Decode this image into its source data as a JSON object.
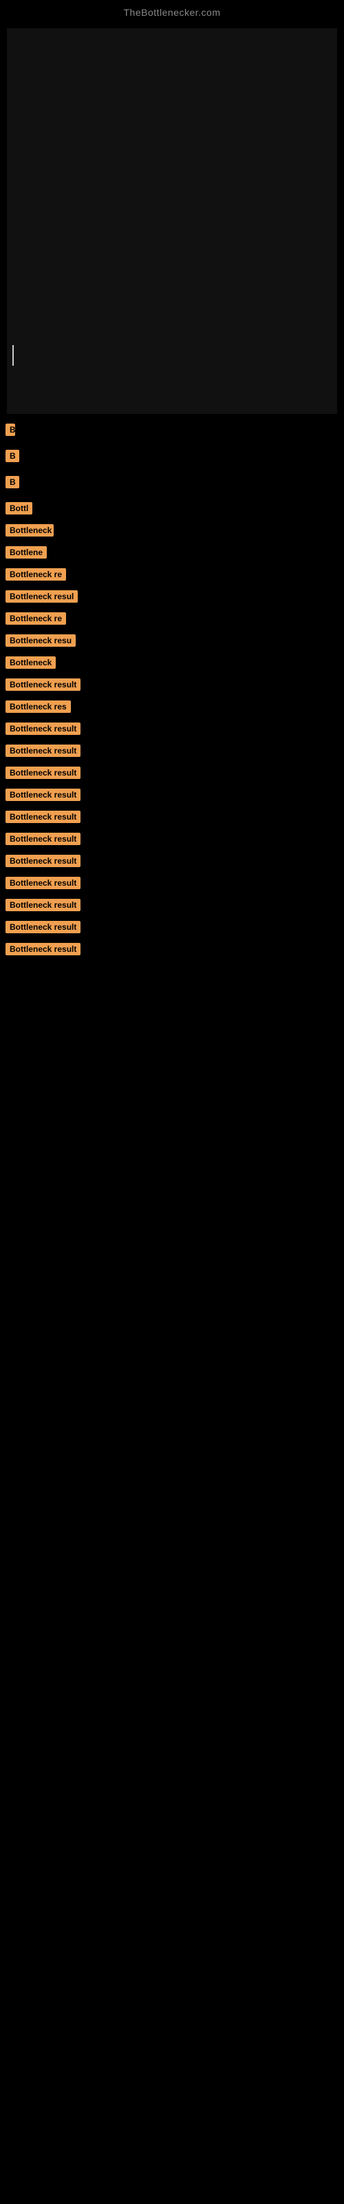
{
  "site": {
    "title": "TheBottlenecker.com"
  },
  "labels": [
    {
      "id": 1,
      "text": "B"
    },
    {
      "id": 2,
      "text": "B"
    },
    {
      "id": 3,
      "text": "B"
    },
    {
      "id": 4,
      "text": "Bottl"
    },
    {
      "id": 5,
      "text": "Bottleneck"
    },
    {
      "id": 6,
      "text": "Bottlene"
    },
    {
      "id": 7,
      "text": "Bottleneck re"
    },
    {
      "id": 8,
      "text": "Bottleneck resul"
    },
    {
      "id": 9,
      "text": "Bottleneck re"
    },
    {
      "id": 10,
      "text": "Bottleneck resu"
    },
    {
      "id": 11,
      "text": "Bottleneck"
    },
    {
      "id": 12,
      "text": "Bottleneck result"
    },
    {
      "id": 13,
      "text": "Bottleneck res"
    },
    {
      "id": 14,
      "text": "Bottleneck result"
    },
    {
      "id": 15,
      "text": "Bottleneck result"
    },
    {
      "id": 16,
      "text": "Bottleneck result"
    },
    {
      "id": 17,
      "text": "Bottleneck result"
    },
    {
      "id": 18,
      "text": "Bottleneck result"
    },
    {
      "id": 19,
      "text": "Bottleneck result"
    },
    {
      "id": 20,
      "text": "Bottleneck result"
    },
    {
      "id": 21,
      "text": "Bottleneck result"
    },
    {
      "id": 22,
      "text": "Bottleneck result"
    },
    {
      "id": 23,
      "text": "Bottleneck result"
    },
    {
      "id": 24,
      "text": "Bottleneck result"
    }
  ]
}
